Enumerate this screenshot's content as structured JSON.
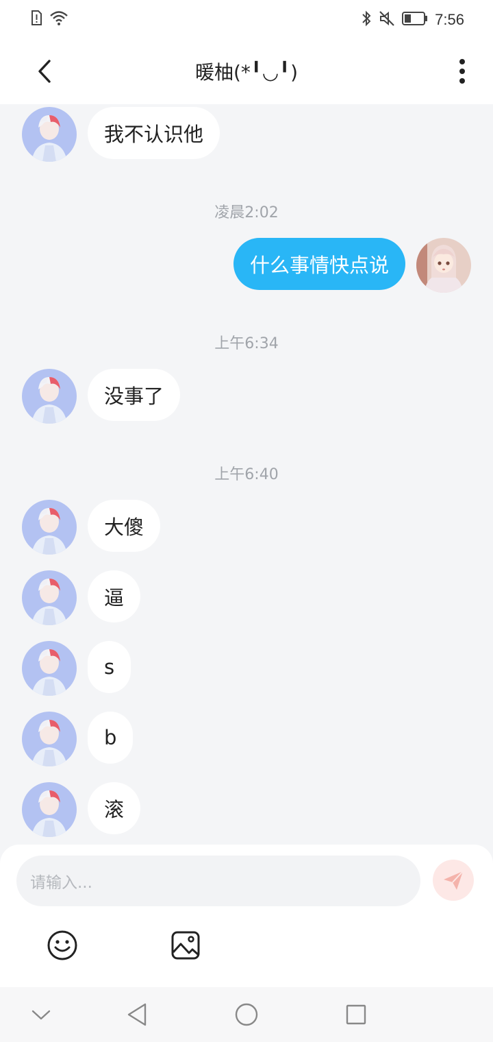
{
  "status_bar": {
    "time": "7:56",
    "icons": [
      "alert-sim-icon",
      "wifi-icon",
      "bluetooth-icon",
      "mute-icon",
      "battery-icon"
    ]
  },
  "header": {
    "title": "暖柚(*╹◡╹)"
  },
  "messages": [
    {
      "type": "text",
      "sender": "other",
      "text": "我不认识他"
    },
    {
      "type": "time",
      "text": "凌晨2:02"
    },
    {
      "type": "text",
      "sender": "me",
      "text": "什么事情快点说"
    },
    {
      "type": "time",
      "text": "上午6:34"
    },
    {
      "type": "text",
      "sender": "other",
      "text": "没事了"
    },
    {
      "type": "time",
      "text": "上午6:40"
    },
    {
      "type": "text",
      "sender": "other",
      "text": "大傻"
    },
    {
      "type": "text",
      "sender": "other",
      "text": "逼"
    },
    {
      "type": "text",
      "sender": "other",
      "text": "s"
    },
    {
      "type": "text",
      "sender": "other",
      "text": "b"
    },
    {
      "type": "text",
      "sender": "other",
      "text": "滚"
    }
  ],
  "composer": {
    "placeholder": "请输入...",
    "tools": [
      "emoji-icon",
      "image-icon"
    ]
  },
  "colors": {
    "accent": "#29b6f6",
    "background": "#f4f5f7",
    "send_button_bg": "#fde8e6",
    "send_icon": "#f4a49a"
  },
  "nav_bar": {
    "buttons": [
      "collapse-icon",
      "back-icon",
      "home-icon",
      "recents-icon"
    ]
  }
}
